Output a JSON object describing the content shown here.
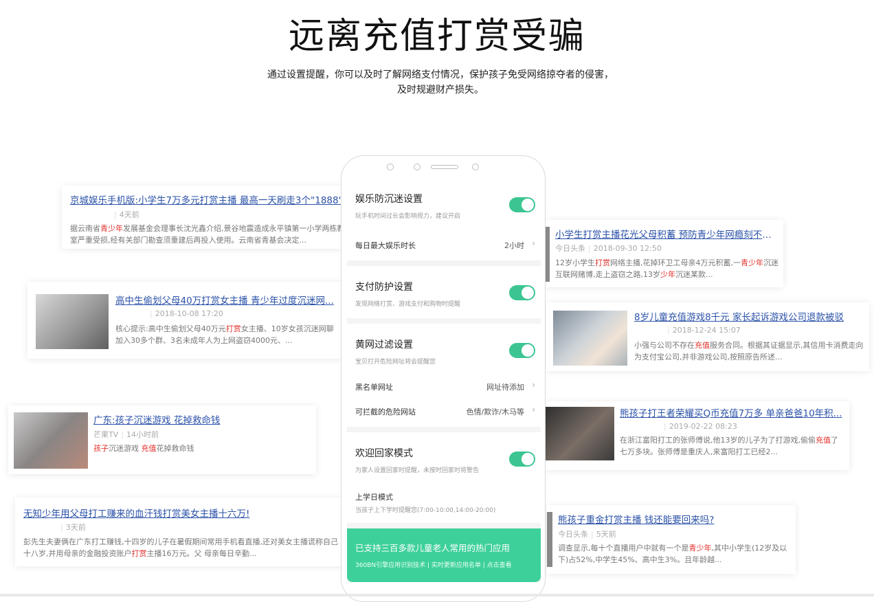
{
  "header": {
    "title": "远离充值打赏受骗",
    "subtitle": "通过设置提醒，你可以及时了解网络支付情况，保护孩子免受网络掠夺者的侵害，及时规避财产损失。"
  },
  "news": [
    {
      "title": "京城娱乐手机版:小学生7万多元打赏主播 最高一天刷走3个\"1888\"",
      "source": "",
      "time": "4天前",
      "body": "据云南省青少年发展基金会理事长沈光鑫介绍,景谷地震造成永平镇第一小学两栋教室严重受损,经有关部门勘查须重建后再投入使用。云南省青基会决定..."
    },
    {
      "title": "高中生偷划父母40万打赏女主播 青少年过度沉迷网...",
      "source": "",
      "time": "2018-10-08 17:20",
      "body": "核心提示:高中生偷划父母40万元打赏女主播、10岁女孩沉迷网聊加入30多个群、3名未成年人为上网盗窃4000元、..."
    },
    {
      "title": "广东:孩子沉迷游戏 花掉救命钱",
      "source": "芒果TV",
      "time": "14小时前",
      "body": "孩子沉迷游戏 充值花掉救命钱"
    },
    {
      "title": "无知少年用父母打工赚来的血汗钱打赏美女主播十六万!",
      "source": "",
      "time": "3天前",
      "body": "彭先生夫妻俩在广东打工赚钱,十四岁的儿子在暑假期间常用手机看直播,还对美女主播谎称自己十八岁,并用母亲的金融投资账户打赏主播16万元。父 母亲每日辛勤..."
    },
    {
      "title": "小学生打赏主播花光父母积蓄 预防青少年网瘾刻不容缓",
      "source": "今日头条",
      "time": "2018-09-30 12:50",
      "body": "12岁小学生打赏网络主播,花掉环卫工母亲4万元积蓄,一青少年沉迷互联网赌博,走上盗窃之路,13岁少年沉迷某款..."
    },
    {
      "title": "8岁儿童充值游戏8千元 家长起诉游戏公司退款被驳",
      "source": "",
      "time": "2018-12-24 15:07",
      "body": "小强与公司不存在充值服务合同。根据其证据显示,其信用卡消费走向为支付宝公司,并非游戏公司,按照原告所述..."
    },
    {
      "title": "熊孩子打王者荣耀买Q币充值7万多 单亲爸爸10年积...",
      "source": "",
      "time": "2019-02-22 08:23",
      "body": "在浙江富阳打工的张师傅说,他13岁的儿子为了打游戏,偷偷充值了七万多块。张师傅是重庆人,来富阳打工已经2..."
    },
    {
      "title": "熊孩子重金打赏主播 钱还能要回来吗?",
      "source": "今日头条",
      "time": "5天前",
      "body": "调查显示,每十个直播用户中就有一个是青少年,其中小学生(12岁及以下)占52%,中学生45%、高中生3%。且年龄越..."
    }
  ],
  "phone": {
    "s1": {
      "title": "娱乐防沉迷设置",
      "desc": "玩手机时间过长会影响视力，建议开启",
      "row_label": "每日最大娱乐时长",
      "row_value": "2小时"
    },
    "s2": {
      "title": "支付防护设置",
      "desc": "发现网络打赏、游戏支付和购物时提醒"
    },
    "s3": {
      "title": "黄网过滤设置",
      "desc": "宝贝打开危险网址将会提醒您",
      "row1_label": "黑名单网址",
      "row1_value": "网址待添加",
      "row2_label": "可拦截的危险网站",
      "row2_value": "色情/欺诈/木马等"
    },
    "s4": {
      "title": "欢迎回家模式",
      "desc": "为家人设置回家时提醒，未按时回家时将警告",
      "row_label": "上学日模式",
      "row_desc": "当孩子上下学时提醒您(7:00-10:00,14:00-20:00)"
    },
    "banner": {
      "title": "已支持三百多款儿童老人常用的热门应用",
      "sub": "360BN引擎应用识别技术 | 实时更新应用名单 | 点击查看"
    },
    "chevron": "›",
    "toggle_color": "#3cc592",
    "banner_color": "#3ed09a"
  }
}
